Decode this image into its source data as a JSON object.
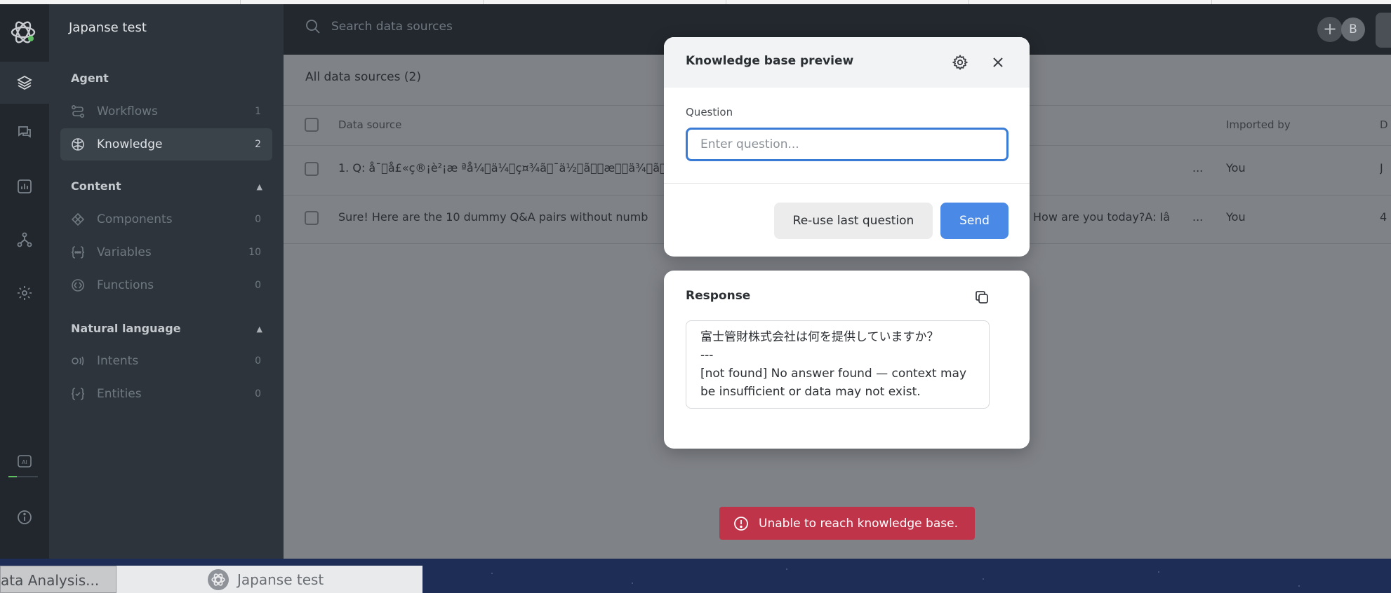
{
  "project_name": "Japanse test",
  "colors": {
    "accent": "#4a8ae6",
    "error": "#c0344a",
    "sidebar_bg": "#2d343b",
    "rail_bg": "#22272d"
  },
  "sidebar": {
    "sections": [
      {
        "title": "Agent"
      },
      {
        "title": "Content"
      },
      {
        "title": "Natural language"
      }
    ],
    "items": [
      {
        "label": "Workflows",
        "count": "1",
        "icon": "workflow-icon"
      },
      {
        "label": "Knowledge",
        "count": "2",
        "icon": "knowledge-icon"
      },
      {
        "label": "Components",
        "count": "0",
        "icon": "components-icon"
      },
      {
        "label": "Variables",
        "count": "10",
        "icon": "variables-icon"
      },
      {
        "label": "Functions",
        "count": "0",
        "icon": "functions-icon"
      },
      {
        "label": "Intents",
        "count": "0",
        "icon": "intents-icon"
      },
      {
        "label": "Entities",
        "count": "0",
        "icon": "entities-icon"
      }
    ]
  },
  "topbar": {
    "search_placeholder": "Search data sources",
    "avatar_initial": "B",
    "add_label": "+"
  },
  "table": {
    "title": "All data sources (2)",
    "columns": [
      "Data source",
      "Imported by"
    ],
    "rows": [
      {
        "source": "1. Q: åˉ\u0000å£«ç®¡è²¡æ ªå¼\u0000ä¼\u0000ç¤¾ã\u0000¯ä½\u0000ã\u0000\u0000æ\u0000\u0000ä¾\u0000ã\u0000",
        "snippet": "",
        "ellipsis": "...",
        "imported_by": "You",
        "extra": "J"
      },
      {
        "source": "Sure! Here are the 10 dummy Q&A pairs without numb",
        "snippet": "How are you today?A: Iâ",
        "ellipsis": "...",
        "imported_by": "You",
        "extra": "4"
      }
    ]
  },
  "preview": {
    "title": "Knowledge base preview",
    "question_label": "Question",
    "question_placeholder": "Enter question...",
    "reuse_label": "Re-use last question",
    "send_label": "Send"
  },
  "response": {
    "title": "Response",
    "lines": [
      "富士管財株式会社は何を提供していますか？",
      "---",
      "[not found] No answer found — context may",
      "be insufficient or data may not exist."
    ]
  },
  "toast": {
    "message": "Unable to reach knowledge base."
  },
  "taskbar": {
    "tab1": "ata Analysis...",
    "tab2": "Japanse test"
  }
}
